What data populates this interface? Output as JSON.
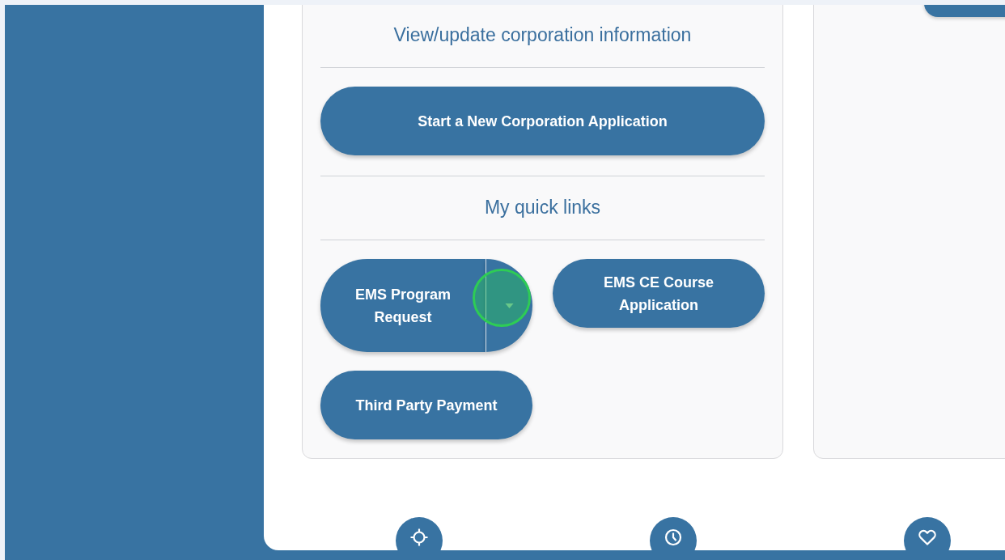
{
  "cards": [
    {
      "title": "View/update corporation information",
      "primary_button": "Start a New Corporation Application",
      "quick_links_heading": "My quick links",
      "quick_links": [
        {
          "label": "EMS Program Request",
          "kind": "split"
        },
        {
          "label": "EMS CE Course Application",
          "kind": "plain"
        },
        {
          "label": "Third Party Payment",
          "kind": "plain"
        }
      ]
    }
  ]
}
